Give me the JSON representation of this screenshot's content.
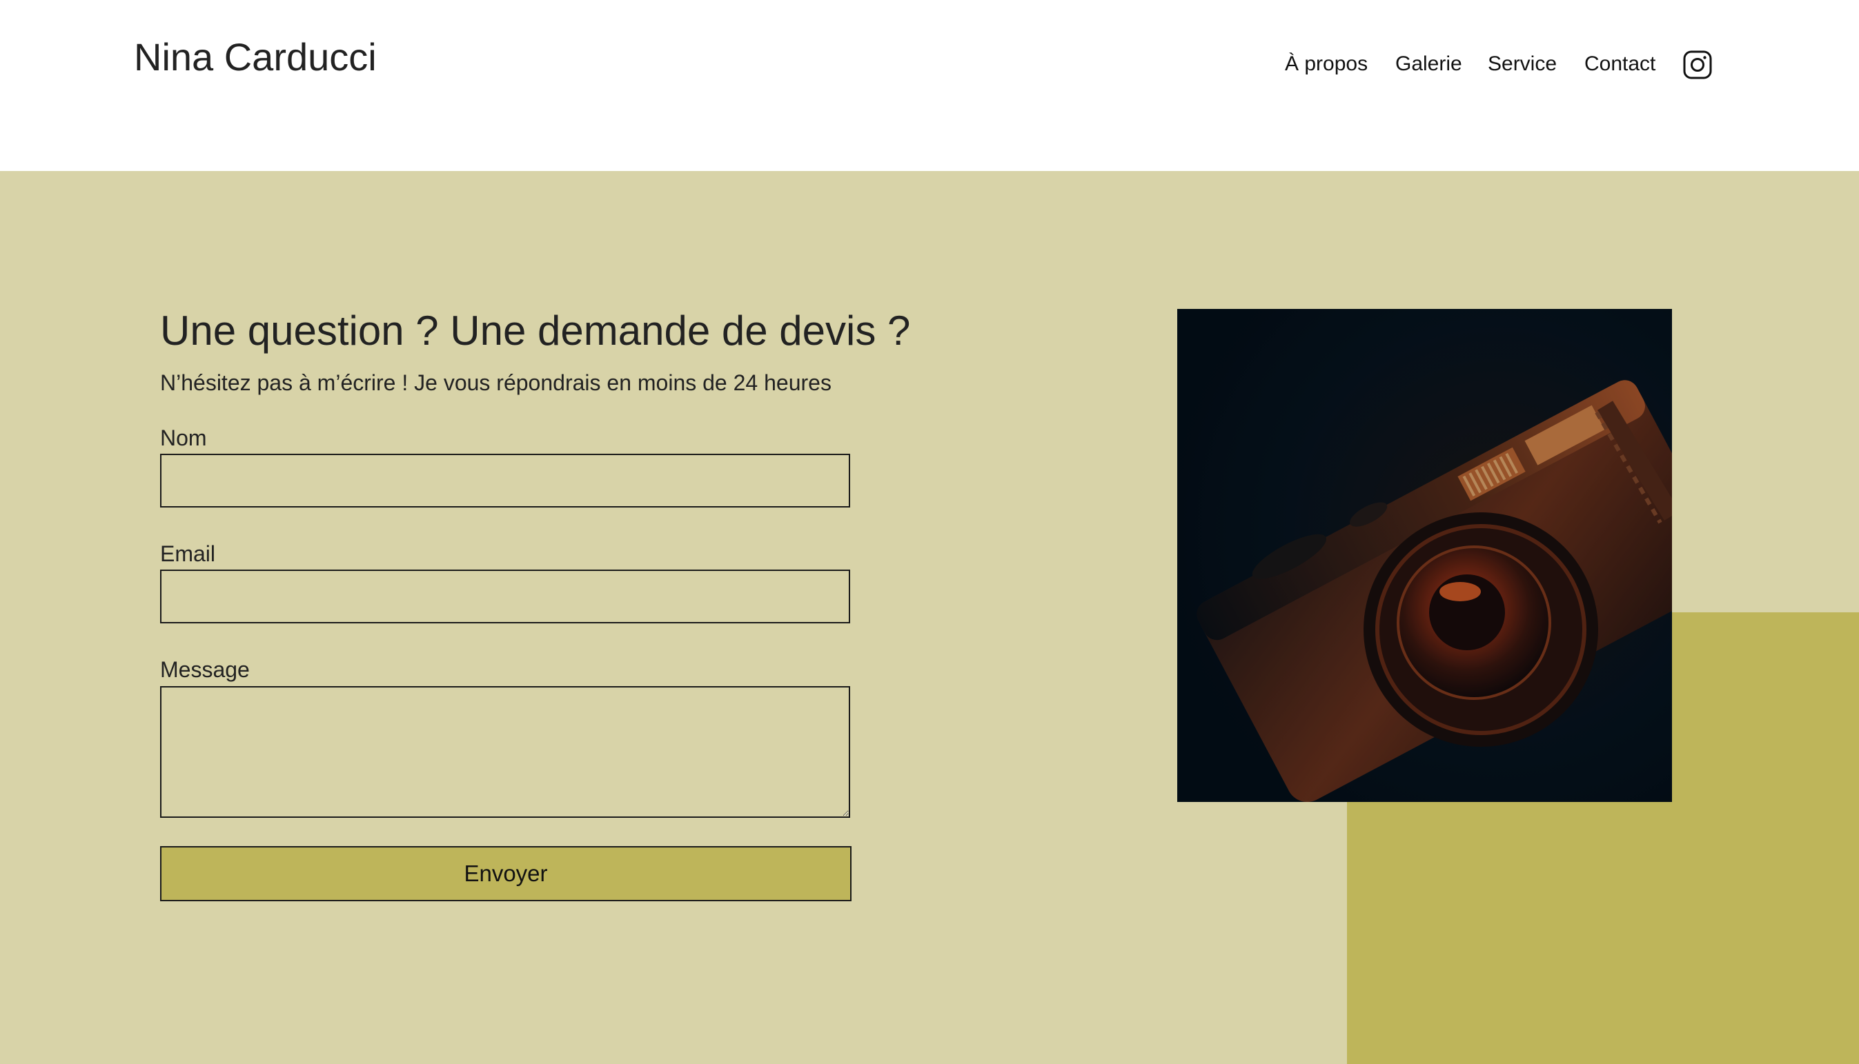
{
  "site": {
    "brand": "Nina Carducci"
  },
  "nav": {
    "items": [
      {
        "label": "À propos"
      },
      {
        "label": "Galerie"
      },
      {
        "label": "Service"
      },
      {
        "label": "Contact"
      }
    ],
    "instagram_icon": "instagram-icon"
  },
  "contact": {
    "title": "Une question ? Une demande de devis ?",
    "subtitle": "N’hésitez pas à m’écrire ! Je vous répondrais en moins de 24 heures",
    "fields": {
      "name_label": "Nom",
      "name_value": "",
      "email_label": "Email",
      "email_value": "",
      "message_label": "Message",
      "message_value": ""
    },
    "submit_label": "Envoyer",
    "photo_icon": "camera-photo"
  },
  "colors": {
    "section_background": "#d8d3a8",
    "accent": "#beb55a",
    "text": "#222222",
    "header_background": "#ffffff"
  }
}
